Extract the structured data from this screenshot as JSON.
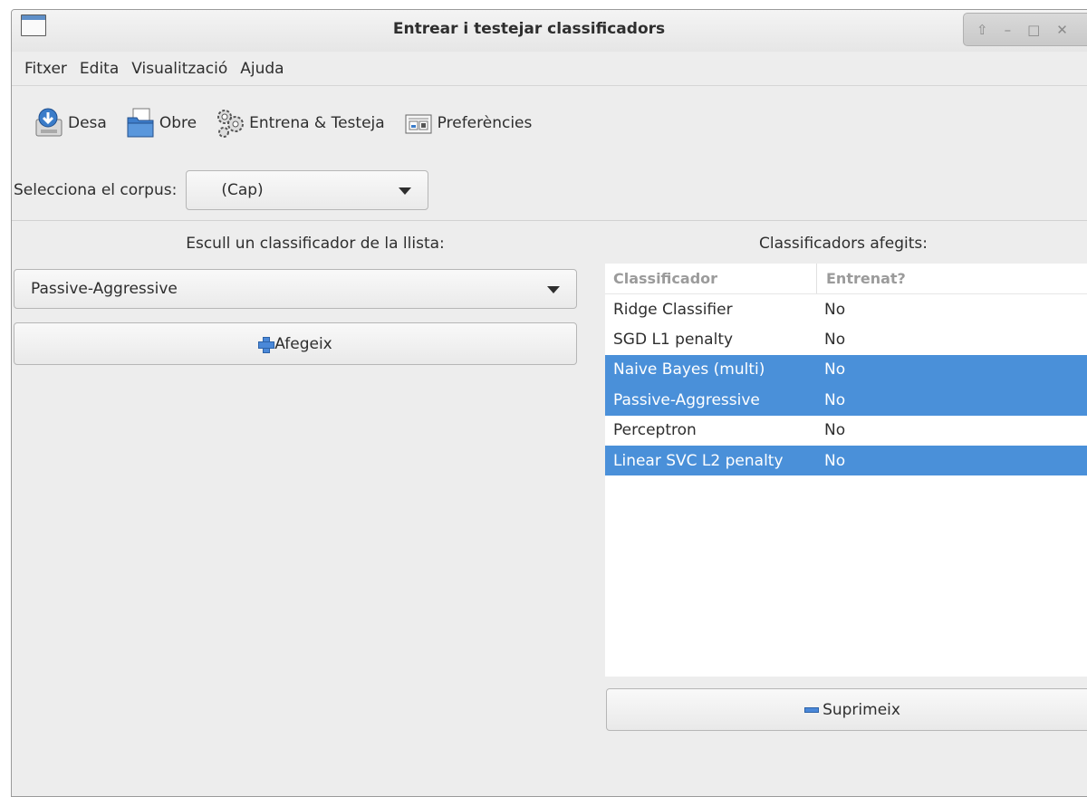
{
  "window": {
    "title": "Entrear i testejar classificadors"
  },
  "window_controls": [
    "⇧",
    "–",
    "□",
    "✕"
  ],
  "menu": [
    "Fitxer",
    "Edita",
    "Visualització",
    "Ajuda"
  ],
  "toolbar": {
    "save": "Desa",
    "open": "Obre",
    "train_test": "Entrena & Testeja",
    "preferences": "Preferències"
  },
  "corpus": {
    "label": "Selecciona el corpus:",
    "selected": "(Cap)"
  },
  "left": {
    "heading": "Escull un classificador de la llista:",
    "selected_classifier": "Passive-Aggressive",
    "add_label": "Afegeix"
  },
  "right": {
    "heading": "Classificadors afegits:",
    "columns": [
      "Classificador",
      "Entrenat?"
    ],
    "rows": [
      {
        "name": "Ridge Classifier",
        "trained": "No",
        "selected": false
      },
      {
        "name": "SGD L1 penalty",
        "trained": "No",
        "selected": false
      },
      {
        "name": "Naive Bayes (multi)",
        "trained": "No",
        "selected": true
      },
      {
        "name": "Passive-Aggressive",
        "trained": "No",
        "selected": true
      },
      {
        "name": "Perceptron",
        "trained": "No",
        "selected": false
      },
      {
        "name": "Linear SVC L2 penalty",
        "trained": "No",
        "selected": true
      }
    ],
    "delete_label": "Suprimeix"
  },
  "colors": {
    "selection": "#4a90d9",
    "window_bg": "#ededed"
  }
}
